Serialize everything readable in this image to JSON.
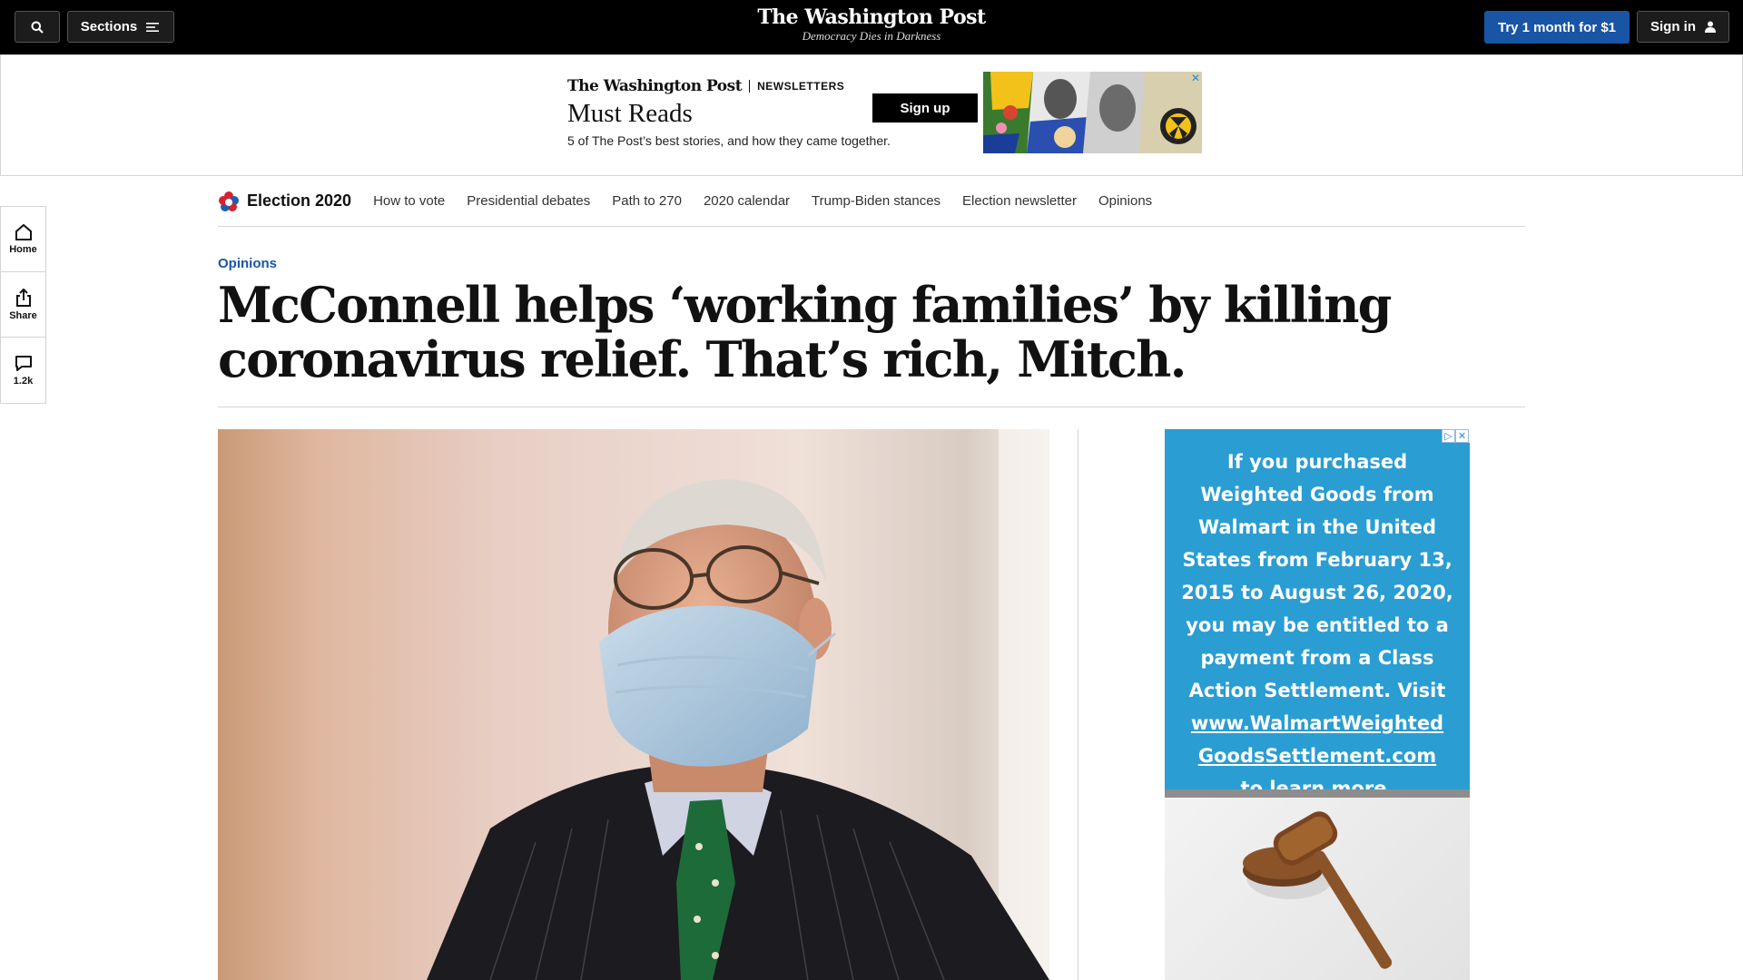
{
  "topbar": {
    "sections_label": "Sections",
    "brand_name": "The Washington Post",
    "brand_tagline": "Democracy Dies in Darkness",
    "try_label": "Try 1 month for $1",
    "signin_label": "Sign in"
  },
  "newsletter_ad": {
    "logo": "The Washington Post",
    "label": "NEWSLETTERS",
    "title": "Must Reads",
    "description": "5 of The Post’s best stories, and how they came together.",
    "cta": "Sign up"
  },
  "election_nav": {
    "title": "Election 2020",
    "items": [
      "How to vote",
      "Presidential debates",
      "Path to 270",
      "2020 calendar",
      "Trump-Biden stances",
      "Election newsletter",
      "Opinions"
    ]
  },
  "rail": {
    "home_label": "Home",
    "share_label": "Share",
    "comments_count": "1.2k"
  },
  "article": {
    "kicker": "Opinions",
    "headline": "McConnell helps ‘working families’ by killing coronavirus relief. That’s rich, Mitch."
  },
  "side_ad": {
    "line1": "If you purchased Weighted Goods from Walmart in the United States from February 13, 2015 to August 26, 2020, you may be entitled to a payment from a Class Action Settlement. Visit",
    "link1": "www.WalmartWeighted",
    "link2": "GoodsSettlement.com",
    "line2": "to learn more."
  },
  "colors": {
    "accent_blue": "#1955a5",
    "ad_blue": "#2a9dd2",
    "topbar_bg": "#000000"
  }
}
